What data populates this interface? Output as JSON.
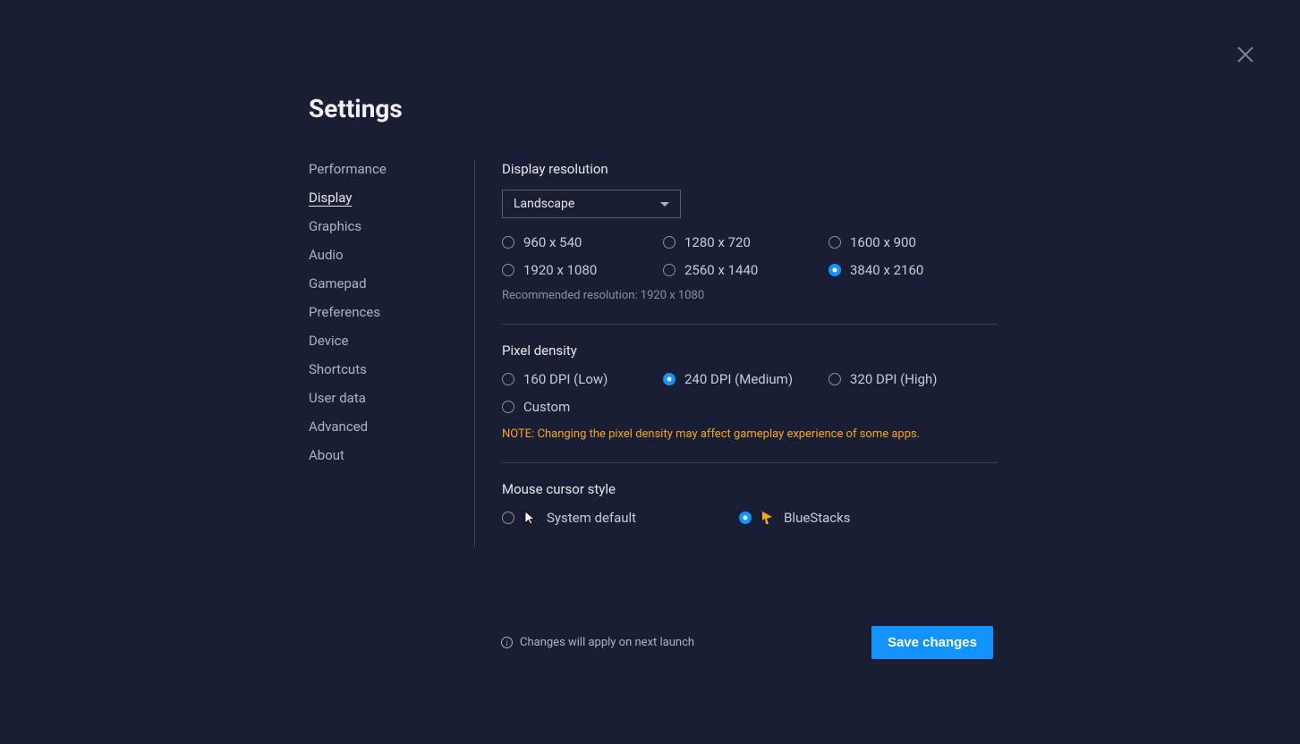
{
  "page_title": "Settings",
  "sidebar": {
    "items": [
      {
        "label": "Performance",
        "active": false
      },
      {
        "label": "Display",
        "active": true
      },
      {
        "label": "Graphics",
        "active": false
      },
      {
        "label": "Audio",
        "active": false
      },
      {
        "label": "Gamepad",
        "active": false
      },
      {
        "label": "Preferences",
        "active": false
      },
      {
        "label": "Device",
        "active": false
      },
      {
        "label": "Shortcuts",
        "active": false
      },
      {
        "label": "User data",
        "active": false
      },
      {
        "label": "Advanced",
        "active": false
      },
      {
        "label": "About",
        "active": false
      }
    ]
  },
  "display_resolution": {
    "title": "Display resolution",
    "orientation_selected": "Landscape",
    "options": [
      {
        "label": "960 x 540",
        "selected": false
      },
      {
        "label": "1280 x 720",
        "selected": false
      },
      {
        "label": "1600 x 900",
        "selected": false
      },
      {
        "label": "1920 x 1080",
        "selected": false
      },
      {
        "label": "2560 x 1440",
        "selected": false
      },
      {
        "label": "3840 x 2160",
        "selected": true
      }
    ],
    "recommended": "Recommended resolution: 1920 x 1080"
  },
  "pixel_density": {
    "title": "Pixel density",
    "options": [
      {
        "label": "160 DPI (Low)",
        "selected": false
      },
      {
        "label": "240 DPI (Medium)",
        "selected": true
      },
      {
        "label": "320 DPI (High)",
        "selected": false
      },
      {
        "label": "Custom",
        "selected": false
      }
    ],
    "note": "NOTE: Changing the pixel density may affect gameplay experience of some apps."
  },
  "mouse_cursor": {
    "title": "Mouse cursor style",
    "options": [
      {
        "label": "System default",
        "selected": false,
        "icon": "arrow-white"
      },
      {
        "label": "BlueStacks",
        "selected": true,
        "icon": "arrow-gold"
      }
    ]
  },
  "footer": {
    "info": "Changes will apply on next launch",
    "save_label": "Save changes"
  }
}
